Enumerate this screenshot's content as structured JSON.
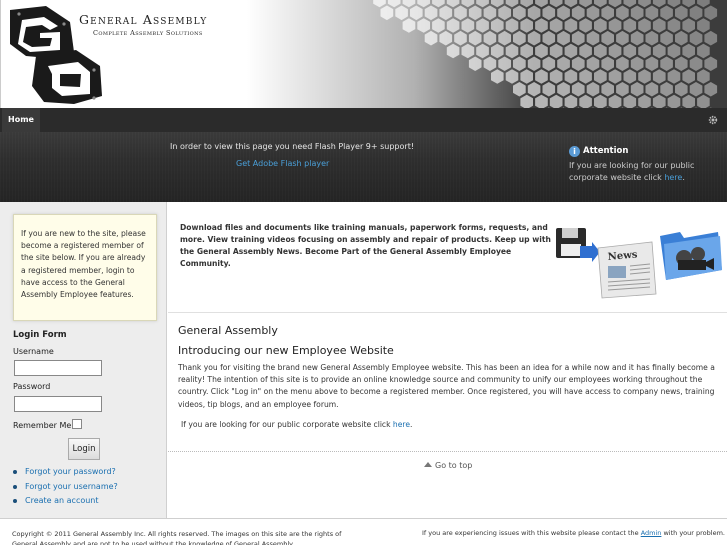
{
  "header": {
    "title": "General Assembly",
    "subtitle": "Complete Assembly Solutions"
  },
  "nav": {
    "home": "Home"
  },
  "banner": {
    "flash_message": "In order to view this page you need Flash Player 9+ support!",
    "flash_link": "Get Adobe Flash player",
    "attention_title": "Attention",
    "attention_text": "If you are looking for our public corporate website click ",
    "attention_link": "here",
    "attention_suffix": "."
  },
  "sidebar": {
    "intro": "If you are new to the site, please become a registered member of the site below. If you are already a registered member, login to have access to the General Assembly Employee features.",
    "login_title": "Login Form",
    "username_label": "Username",
    "password_label": "Password",
    "remember_label": "Remember Me",
    "login_button": "Login",
    "links": [
      "Forgot your password?",
      "Forgot your username?",
      "Create an account"
    ]
  },
  "feature": {
    "text": "Download files and documents like training manuals, paperwork forms, requests, and more. View training videos focusing on assembly and repair of products. Keep up with the General Assembly News. Become Part of the General Assembly Employee Community.",
    "news_label": "News"
  },
  "main": {
    "heading": "General Assembly",
    "subheading": "Introducing our new Employee Website",
    "body": "Thank you for visiting the brand new General Assembly Employee website. This has been an idea for a while now and it has finally become a reality! The intention of this site is to provide an online knowledge source and community to unify our employees working throughout the country. Click \"Log in\" on the menu above to become a registered member. Once registered, you will have access to company news, training videos, tip blogs, and an employee forum.",
    "corporate_text": "If you are looking for our public corporate website click ",
    "corporate_link": "here",
    "corporate_suffix": ".",
    "go_top": "Go to top"
  },
  "footer": {
    "copyright": "Copyright © 2011 General Assembly Inc. All rights reserved. The images on this site are the rights of General Assembly and are not to be used without the knowledge of General Assembly.",
    "issues_text": "If you are experiencing issues with this website please contact the ",
    "issues_link": "Admin",
    "issues_suffix": " with your problem."
  },
  "colors": {
    "nav_bg": "#2b2b2b",
    "link": "#1a6fb0",
    "banner_link": "#4a9fd8",
    "intro_bg": "#fffde9"
  }
}
